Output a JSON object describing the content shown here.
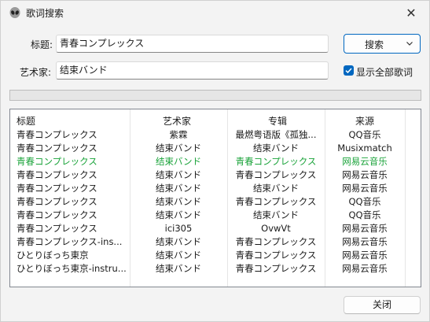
{
  "window": {
    "title": "歌词搜索",
    "close_glyph": "✕"
  },
  "form": {
    "title_label": "标题:",
    "title_value": "青春コンプレックス",
    "artist_label": "艺术家:",
    "artist_value": "结束バンド",
    "search_button": "搜索",
    "show_all_label": "显示全部歌词",
    "show_all_checked": true
  },
  "progress": {
    "value": 0
  },
  "table": {
    "headers": [
      "标题",
      "艺术家",
      "专辑",
      "来源"
    ],
    "rows": [
      {
        "title": "青春コンプレックス",
        "artist": "紫霖",
        "album": "最燃粤语版《孤独...",
        "source": "QQ音乐",
        "highlight": false
      },
      {
        "title": "青春コンプレックス",
        "artist": "结束バンド",
        "album": "结束バンド",
        "source": "Musixmatch",
        "highlight": false
      },
      {
        "title": "青春コンプレックス",
        "artist": "结束バンド",
        "album": "青春コンプレックス",
        "source": "网易云音乐",
        "highlight": true
      },
      {
        "title": "青春コンプレックス",
        "artist": "结束バンド",
        "album": "青春コンプレックス",
        "source": "网易云音乐",
        "highlight": false
      },
      {
        "title": "青春コンプレックス",
        "artist": "结束バンド",
        "album": "结束バンド",
        "source": "网易云音乐",
        "highlight": false
      },
      {
        "title": "青春コンプレックス",
        "artist": "结束バンド",
        "album": "青春コンプレックス",
        "source": "QQ音乐",
        "highlight": false
      },
      {
        "title": "青春コンプレックス",
        "artist": "结束バンド",
        "album": "结束バンド",
        "source": "QQ音乐",
        "highlight": false
      },
      {
        "title": "青春コンプレックス",
        "artist": "ici305",
        "album": "OvwVt",
        "source": "网易云音乐",
        "highlight": false
      },
      {
        "title": "青春コンプレックス-ins...",
        "artist": "结束バンド",
        "album": "青春コンプレックス",
        "source": "网易云音乐",
        "highlight": false
      },
      {
        "title": "ひとりぼっち東京",
        "artist": "结束バンド",
        "album": "青春コンプレックス",
        "source": "网易云音乐",
        "highlight": false
      },
      {
        "title": "ひとりぼっち東京-instru...",
        "artist": "结束バンド",
        "album": "青春コンプレックス",
        "source": "网易云音乐",
        "highlight": false
      }
    ]
  },
  "footer": {
    "close_button": "关闭"
  },
  "colors": {
    "accent": "#0067c0",
    "highlight": "#1aa33a"
  }
}
